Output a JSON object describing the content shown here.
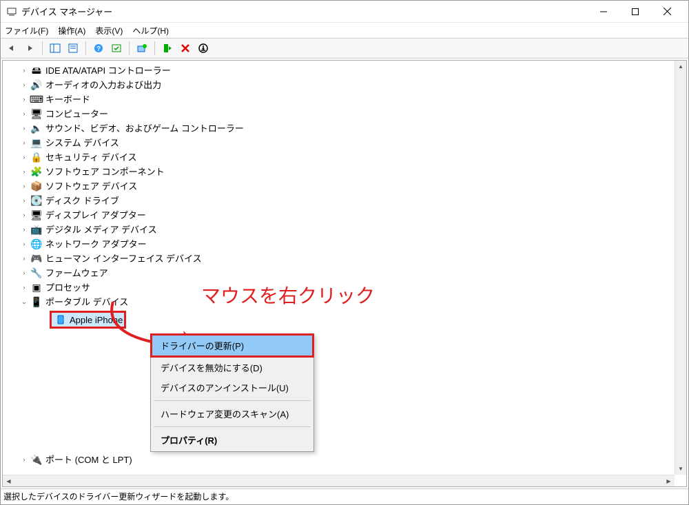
{
  "window": {
    "title": "デバイス マネージャー"
  },
  "menu": {
    "file": "ファイル(F)",
    "action": "操作(A)",
    "view": "表示(V)",
    "help": "ヘルプ(H)"
  },
  "tree": {
    "items": [
      {
        "label": "IDE ATA/ATAPI コントローラー",
        "icon": "🖴"
      },
      {
        "label": "オーディオの入力および出力",
        "icon": "🔊"
      },
      {
        "label": "キーボード",
        "icon": "⌨"
      },
      {
        "label": "コンピューター",
        "icon": "🖥"
      },
      {
        "label": "サウンド、ビデオ、およびゲーム コントローラー",
        "icon": "🔈"
      },
      {
        "label": "システム デバイス",
        "icon": "💻"
      },
      {
        "label": "セキュリティ デバイス",
        "icon": "🔒"
      },
      {
        "label": "ソフトウェア コンポーネント",
        "icon": "🧩"
      },
      {
        "label": "ソフトウェア デバイス",
        "icon": "📦"
      },
      {
        "label": "ディスク ドライブ",
        "icon": "💽"
      },
      {
        "label": "ディスプレイ アダプター",
        "icon": "🖥"
      },
      {
        "label": "デジタル メディア デバイス",
        "icon": "📺"
      },
      {
        "label": "ネットワーク アダプター",
        "icon": "🌐"
      },
      {
        "label": "ヒューマン インターフェイス デバイス",
        "icon": "🎮"
      },
      {
        "label": "ファームウェア",
        "icon": "🔧"
      },
      {
        "label": "プロセッサ",
        "icon": "▣"
      },
      {
        "label": "ポータブル デバイス",
        "icon": "📱",
        "expanded": true
      }
    ],
    "selected_child": {
      "label": "Apple iPhone",
      "icon": "📱"
    },
    "last": {
      "label": "ポート (COM と LPT)",
      "icon": "🔌"
    }
  },
  "context_menu": {
    "items": [
      {
        "label": "ドライバーの更新(P)",
        "highlight": true
      },
      {
        "label": "デバイスを無効にする(D)"
      },
      {
        "label": "デバイスのアンインストール(U)"
      },
      {
        "sep": true
      },
      {
        "label": "ハードウェア変更のスキャン(A)"
      },
      {
        "sep": true
      },
      {
        "label": "プロパティ(R)",
        "bold": true
      }
    ]
  },
  "annotation": {
    "text": "マウスを右クリック"
  },
  "statusbar": {
    "text": "選択したデバイスのドライバー更新ウィザードを起動します。"
  }
}
